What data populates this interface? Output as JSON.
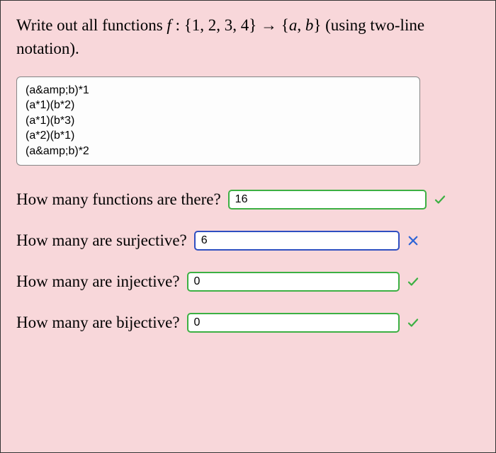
{
  "prompt": {
    "pre": "Write out all functions ",
    "f": "f",
    "colon": " : {1, 2, 3, 4} ",
    "arrow": "→",
    "codomain_open": " {",
    "a": "a",
    "sep": ", ",
    "b": "b",
    "codomain_close": "} ",
    "post": "(using two-line notation)."
  },
  "textarea_lines": [
    "(a&amp;b)*1",
    "(a*1)(b*2)",
    "(a*1)(b*3)",
    "(a*2)(b*1)",
    "(a&amp;b)*2"
  ],
  "questions": {
    "count": {
      "label": "How many functions are there?",
      "value": "16",
      "status": "correct"
    },
    "surjective": {
      "label": "How many are surjective?",
      "value": "6",
      "status": "wrong"
    },
    "injective": {
      "label": "How many are injective?",
      "value": "0",
      "status": "correct"
    },
    "bijective": {
      "label": "How many are bijective?",
      "value": "0",
      "status": "correct"
    }
  }
}
